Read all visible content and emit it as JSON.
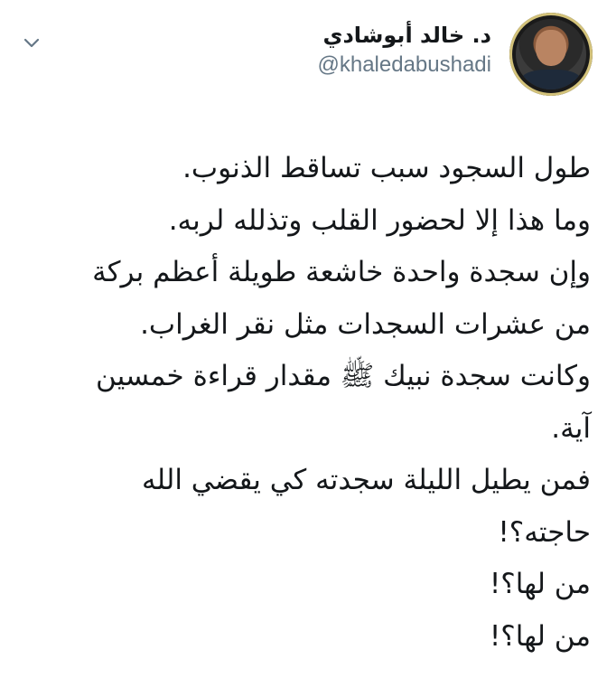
{
  "author": {
    "display_name": "د. خالد أبوشادي",
    "handle": "@khaledabushadi"
  },
  "icons": {
    "menu": "chevron-down-icon",
    "avatar": "profile-photo"
  },
  "tweet": {
    "lines": [
      "طول السجود سبب تساقط الذنوب.",
      "وما هذا إلا لحضور القلب وتذلله لربه.",
      "وإن سجدة واحدة خاشعة طويلة أعظم بركة",
      "من عشرات السجدات مثل نقر الغراب.",
      "وكانت سجدة نبيك ﷺ مقدار قراءة خمسين",
      "آية.",
      "فمن يطيل الليلة سجدته كي يقضي الله",
      "حاجته؟!",
      "من لها؟!",
      "من لها؟!"
    ]
  },
  "colors": {
    "text": "#14171a",
    "secondary": "#657786",
    "avatar_ring": "#d3c27a"
  }
}
